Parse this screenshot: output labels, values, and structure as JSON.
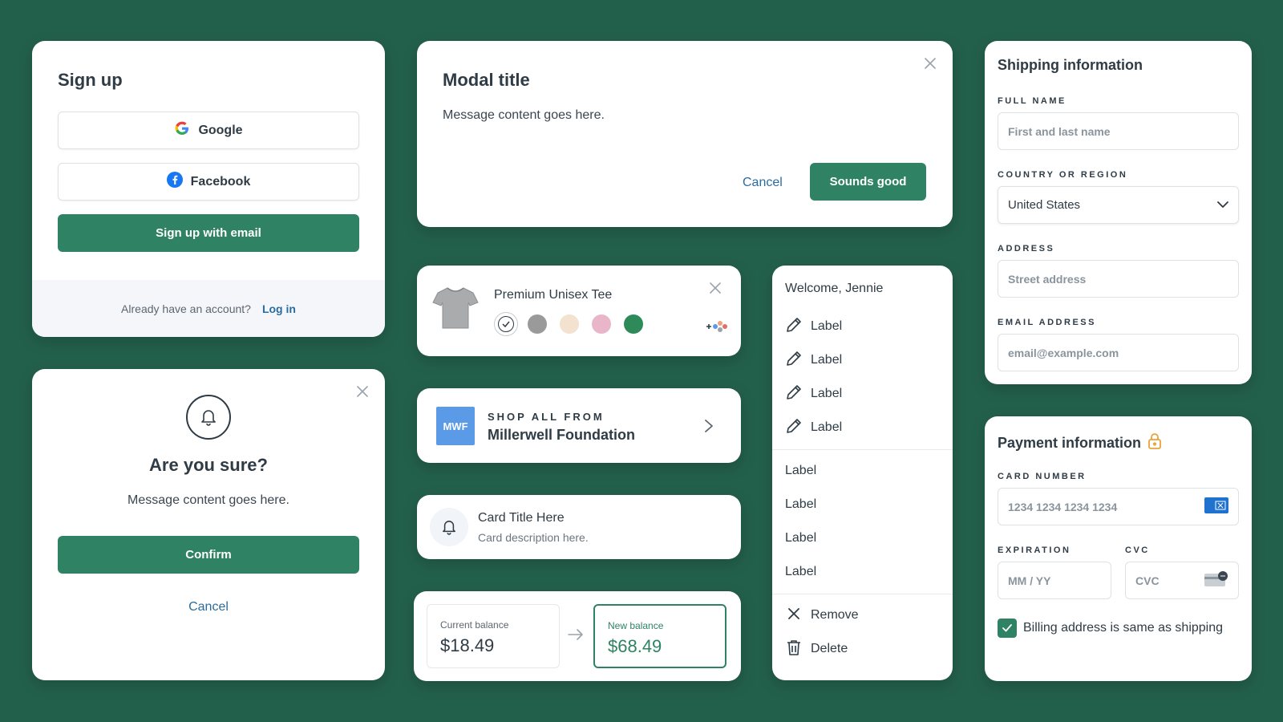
{
  "signup": {
    "title": "Sign up",
    "google_label": "Google",
    "facebook_label": "Facebook",
    "email_label": "Sign up with email",
    "footer_text": "Already have an account?",
    "login_link": "Log in"
  },
  "confirm": {
    "title": "Are you sure?",
    "message": "Message content goes here.",
    "confirm_label": "Confirm",
    "cancel_label": "Cancel"
  },
  "modal": {
    "title": "Modal title",
    "message": "Message content goes here.",
    "cancel_label": "Cancel",
    "ok_label": "Sounds good"
  },
  "product": {
    "name": "Premium Unisex Tee",
    "swatches": [
      "#ffffff",
      "#9a9a9a",
      "#f2e2cf",
      "#e9b6c9",
      "#2f8a5a"
    ],
    "selected_index": 0
  },
  "shop": {
    "logo_text": "MWF",
    "kicker": "SHOP ALL FROM",
    "brand": "Millerwell Foundation"
  },
  "info_card": {
    "title": "Card Title Here",
    "description": "Card description here."
  },
  "balance": {
    "current_label": "Current balance",
    "current_amount": "$18.49",
    "new_label": "New balance",
    "new_amount": "$68.49"
  },
  "menu": {
    "welcome": "Welcome, Jennie",
    "icon_items": [
      "Label",
      "Label",
      "Label",
      "Label"
    ],
    "plain_items": [
      "Label",
      "Label",
      "Label",
      "Label"
    ],
    "remove_label": "Remove",
    "delete_label": "Delete"
  },
  "shipping": {
    "title": "Shipping information",
    "full_name_label": "FULL NAME",
    "full_name_placeholder": "First and last name",
    "country_label": "COUNTRY OR REGION",
    "country_value": "United States",
    "address_label": "ADDRESS",
    "address_placeholder": "Street address",
    "email_label": "EMAIL ADDRESS",
    "email_placeholder": "email@example.com"
  },
  "payment": {
    "title": "Payment information",
    "card_label": "CARD NUMBER",
    "card_placeholder": "1234 1234 1234 1234",
    "exp_label": "EXPIRATION",
    "exp_placeholder": "MM / YY",
    "cvc_label": "CVC",
    "cvc_placeholder": "CVC",
    "billing_label": "Billing address is same as shipping",
    "billing_checked": true
  },
  "colors": {
    "background": "#23604c",
    "primary": "#2f8263",
    "link": "#2b6c9e"
  }
}
